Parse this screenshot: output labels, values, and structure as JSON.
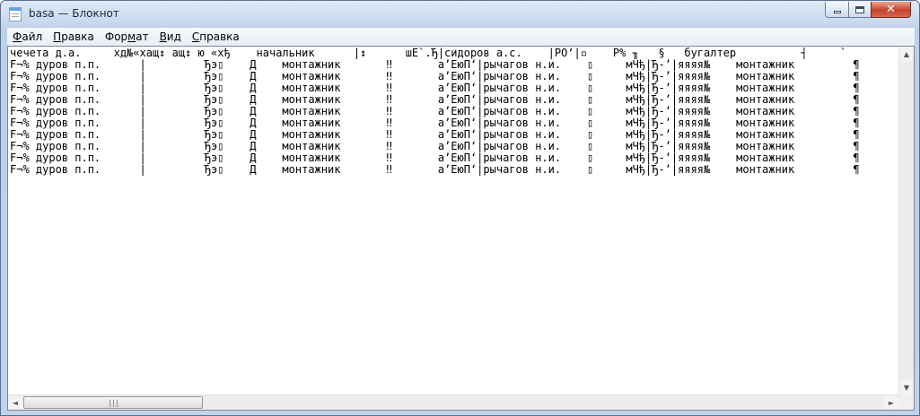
{
  "window": {
    "title": "basa — Блокнот",
    "controls": {
      "minimize": "—",
      "maximize": "□",
      "close": "✕"
    }
  },
  "menu": {
    "items": [
      {
        "label": "Файл",
        "key": "Ф",
        "rest": "айл"
      },
      {
        "label": "Правка",
        "key": "П",
        "rest": "равка"
      },
      {
        "label": "Формат",
        "pre": "Фор",
        "key": "м",
        "rest": "ат"
      },
      {
        "label": "Вид",
        "key": "В",
        "rest": "ид"
      },
      {
        "label": "Справка",
        "key": "С",
        "rest": "правка"
      }
    ]
  },
  "document": {
    "lines": [
      "чечета д.а.     хд№«хащ↕ ащ↕ ю «хђ    начальник      |↕      шЕ`.Ђ|сидоров а.с.    |РО‘|▫    Р% ╖   §   бугалтер          ┤     `",
      "F¬% дуров п.п.      |         Ђэ▯    Д    монтажник       ‼       а’ЕюП‘|рычагов н.и.    ▯     мЧђ|Ђ-’|яяяя№    монтажник         ¶",
      "F¬% дуров п.п.      |         Ђэ▯    Д    монтажник       ‼       а’ЕюП‘|рычагов н.и.    ▯     мЧђ|Ђ-’|яяяя№    монтажник         ¶",
      "F¬% дуров п.п.      |         Ђэ▯    Д    монтажник       ‼       а’ЕюП‘|рычагов н.и.    ▯     мЧђ|Ђ-’|яяяя№    монтажник         ¶",
      "F¬% дуров п.п.      |         Ђэ▯    Д    монтажник       ‼       а’ЕюП‘|рычагов н.и.    ▯     мЧђ|Ђ-’|яяяя№    монтажник         ¶",
      "F¬% дуров п.п.      |         Ђэ▯    Д    монтажник       ‼       а’ЕюП‘|рычагов н.и.    ▯     мЧђ|Ђ-’|яяяя№    монтажник         ¶",
      "F¬% дуров п.п.      |         Ђэ▯    Д    монтажник       ‼       а’ЕюП‘|рычагов н.и.    ▯     мЧђ|Ђ-’|яяяя№    монтажник         ¶",
      "F¬% дуров п.п.      |         Ђэ▯    Д    монтажник       ‼       а’ЕюП‘|рычагов н.и.    ▯     мЧђ|Ђ-’|яяяя№    монтажник         ¶",
      "F¬% дуров п.п.      |         Ђэ▯    Д    монтажник       ‼       а’ЕюП‘|рычагов н.и.    ▯     мЧђ|Ђ-’|яяяя№    монтажник         ¶",
      "F¬% дуров п.п.      |         Ђэ▯    Д    монтажник       ‼       а’ЕюП‘|рычагов н.и.    ▯     мЧђ|Ђ-’|яяяя№    монтажник         ¶",
      "F¬% дуров п.п.      |         Ђэ▯    Д    монтажник       ‼       а’ЕюП‘|рычагов н.и.    ▯     мЧђ|Ђ-’|яяяя№    монтажник         ¶"
    ]
  },
  "scrollbars": {
    "up_arrow": "▲",
    "down_arrow": "▼",
    "left_arrow": "◄",
    "right_arrow": "►",
    "grip": "|||"
  }
}
